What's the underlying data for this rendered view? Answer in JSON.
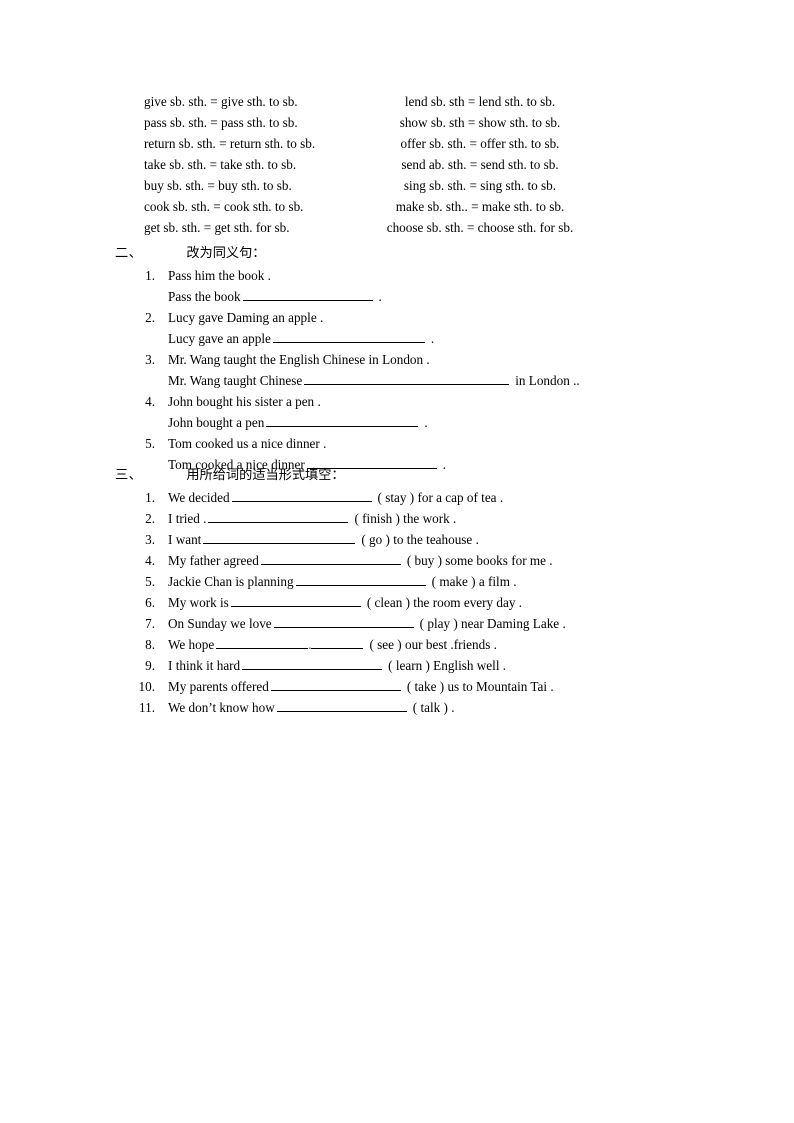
{
  "document": {
    "language": "zh-CN + en",
    "page_background": "#ffffff",
    "text_color": "#000000"
  },
  "equivalence_table": {
    "name": "double-object-to-prepositional-object patterns",
    "rows": [
      {
        "left": "give sb. sth. = give sth. to sb.",
        "right": "lend sb. sth = lend sth. to sb."
      },
      {
        "left": "pass sb. sth. = pass sth. to sb.",
        "right": "show sb. sth = show sth. to sb."
      },
      {
        "left": "return sb. sth. = return sth. to sb.",
        "right": "offer sb. sth. = offer sth. to sb."
      },
      {
        "left": "take sb. sth. = take sth. to sb.",
        "right": "send ab. sth. = send sth. to sb."
      },
      {
        "left": "buy sb. sth. = buy sth. to sb.",
        "right": "sing sb. sth. = sing sth. to sb."
      },
      {
        "left": "cook sb. sth. = cook sth. to sb.",
        "right": "make sb. sth.. = make sth. to sb."
      },
      {
        "left": "get sb. sth. = get sth. for sb.",
        "right": "choose sb. sth. = choose sth. for sb."
      }
    ]
  },
  "section_two": {
    "marker": "二、",
    "title": "改为同义句：",
    "items": [
      {
        "number": "1.",
        "prompt": "Pass him the book .",
        "answer_prefix": "Pass the book",
        "answer_suffix": "."
      },
      {
        "number": "2.",
        "prompt": "Lucy gave Daming an apple .",
        "answer_prefix": "Lucy gave an apple",
        "answer_suffix": "."
      },
      {
        "number": "3.",
        "prompt": "Mr. Wang taught the English Chinese in London .",
        "answer_prefix": "Mr. Wang taught Chinese",
        "answer_suffix": "in London .."
      },
      {
        "number": "4.",
        "prompt": "John bought his sister a pen .",
        "answer_prefix": "John bought a pen",
        "answer_suffix": "."
      },
      {
        "number": "5.",
        "prompt": "Tom cooked us a nice dinner .",
        "answer_prefix": "Tom cooked a nice dinner",
        "answer_suffix": "."
      }
    ]
  },
  "section_three": {
    "marker": "三、",
    "title": "用所给词的适当形式填空：",
    "items": [
      {
        "number": "1.",
        "before": "We decided",
        "after": "( stay ) for a cap of tea ."
      },
      {
        "number": "2.",
        "before": "I tried  .",
        "after": "( finish ) the work ."
      },
      {
        "number": "3.",
        "before": "I want",
        "after": "( go ) to the teahouse ."
      },
      {
        "number": "4.",
        "before": "My father agreed",
        "after": "( buy ) some books for me ."
      },
      {
        "number": "5.",
        "before": "Jackie Chan is planning",
        "after": "( make ) a film ."
      },
      {
        "number": "6.",
        "before": "My work is",
        "after": "( clean ) the room every day ."
      },
      {
        "number": "7.",
        "before": "On Sunday we love",
        "after": "( play ) near Daming Lake ."
      },
      {
        "number": "8.",
        "before": "We hope",
        "after": "( see ) our best  .friends ."
      },
      {
        "number": "9.",
        "before": "I think it hard",
        "after": "( learn ) English well ."
      },
      {
        "number": "10.",
        "before": "My parents offered",
        "after": "( take ) us to Mountain Tai ."
      },
      {
        "number": "11.",
        "before": "We don’t know how",
        "after": "( talk ) ."
      }
    ]
  }
}
